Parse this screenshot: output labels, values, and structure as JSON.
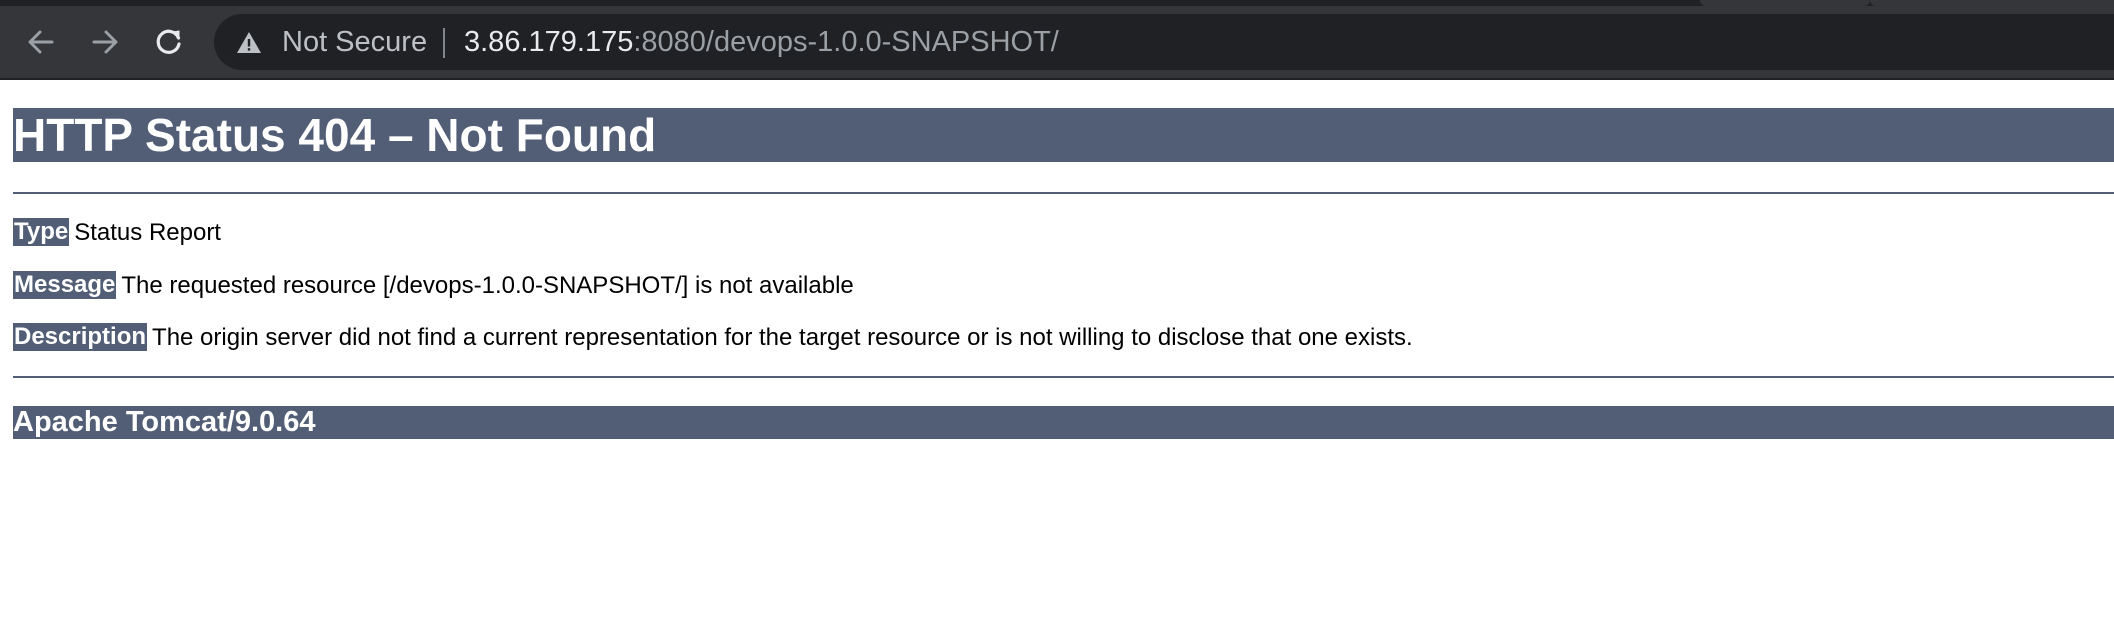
{
  "browser": {
    "security_label": "Not Secure",
    "url_host": "3.86.179.175",
    "url_rest": ":8080/devops-1.0.0-SNAPSHOT/",
    "icons": {
      "back": "arrow-left",
      "forward": "arrow-right",
      "reload": "circular-arrow",
      "security": "warning-triangle"
    },
    "colors": {
      "toolbar": "#35363a",
      "omnibox": "#202124",
      "url_host_text": "#e8eaed",
      "url_secondary_text": "#9aa0a6"
    }
  },
  "page": {
    "title": "HTTP Status 404 – Not Found",
    "rows": [
      {
        "label": "Type",
        "value": "Status Report"
      },
      {
        "label": "Message",
        "value": "The requested resource [/devops-1.0.0-SNAPSHOT/] is not available"
      },
      {
        "label": "Description",
        "value": "The origin server did not find a current representation for the target resource or is not willing to disclose that one exists."
      }
    ],
    "server_info": "Apache Tomcat/9.0.64",
    "colors": {
      "banner_background": "#525d76",
      "banner_text": "#ffffff",
      "body_text": "#000000"
    }
  }
}
